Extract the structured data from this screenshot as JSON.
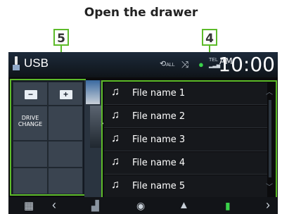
{
  "caption": "Open the drawer",
  "callouts": {
    "left": "5",
    "right": "4"
  },
  "header": {
    "source_label": "USB",
    "repeat_label": "ALL",
    "tel_label": "TEL",
    "ampm": "AM",
    "time": "10:00"
  },
  "drawer": {
    "drive_change_label": "DRIVE\nCHANGE",
    "folder_up_label": "−",
    "folder_open_label": "+"
  },
  "file_list": [
    {
      "name": "File name 1"
    },
    {
      "name": "File name 2"
    },
    {
      "name": "File name 3"
    },
    {
      "name": "File name 4"
    },
    {
      "name": "File name 5"
    }
  ],
  "icons": {
    "music_note": "music-note-icon",
    "shuffle": "shuffle-icon",
    "repeat": "repeat-icon",
    "phone": "phone-icon",
    "menu": "grid-menu-icon"
  },
  "colors": {
    "callout": "#5dbb2a",
    "screen_bg": "#0b0b0d",
    "row_bg": "#16181c"
  }
}
